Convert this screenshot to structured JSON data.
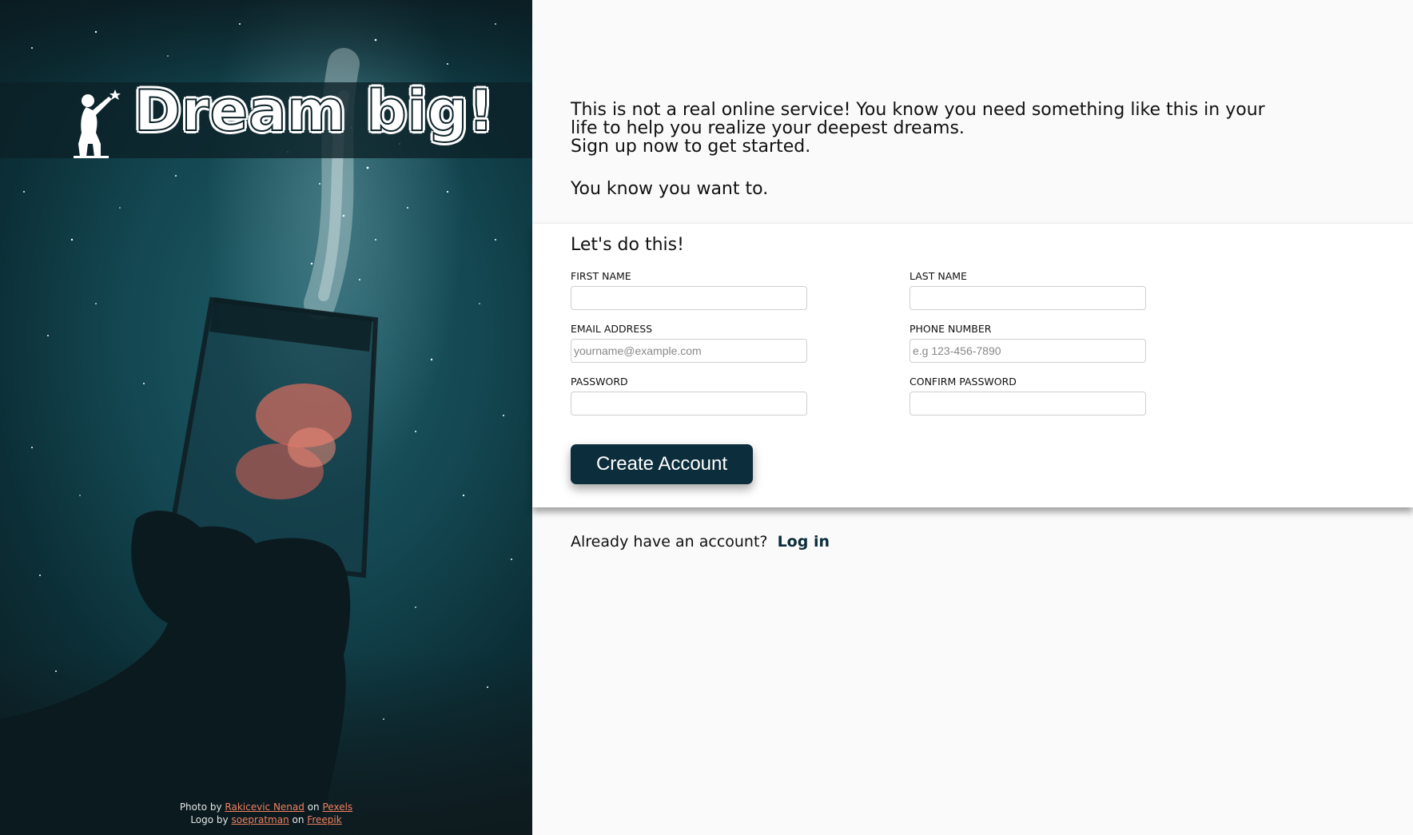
{
  "brand": {
    "title": "Dream big!",
    "logo_icon": "child-reaching-for-star-icon"
  },
  "credits": {
    "photo_prefix": "Photo by",
    "photo_author": "Rakicevic Nenad",
    "on_1": "on",
    "photo_site": "Pexels",
    "logo_prefix": "Logo by",
    "logo_author": "soepratman",
    "on_2": "on",
    "logo_site": "Freepik"
  },
  "intro": {
    "line1": "This is not a real online service! You know you need something like this in your life to help you realize your deepest dreams.",
    "line2": "Sign up now to get started.",
    "line3": "You know you want to."
  },
  "form": {
    "title": "Let's do this!",
    "first_name": {
      "label": "FIRST NAME",
      "value": "",
      "placeholder": ""
    },
    "last_name": {
      "label": "LAST NAME",
      "value": "",
      "placeholder": ""
    },
    "email": {
      "label": "EMAIL ADDRESS",
      "value": "",
      "placeholder": "yourname@example.com"
    },
    "phone": {
      "label": "PHONE NUMBER",
      "value": "",
      "placeholder": "e.g 123-456-7890"
    },
    "password": {
      "label": "PASSWORD",
      "value": "",
      "placeholder": ""
    },
    "confirm_password": {
      "label": "CONFIRM PASSWORD",
      "value": "",
      "placeholder": ""
    },
    "submit_label": "Create Account"
  },
  "login": {
    "prompt": "Already have an account?",
    "link_label": "Log in"
  },
  "colors": {
    "accent": "#0c2d3b",
    "credit_link": "#f08060",
    "panel_bg": "#fafafa"
  }
}
